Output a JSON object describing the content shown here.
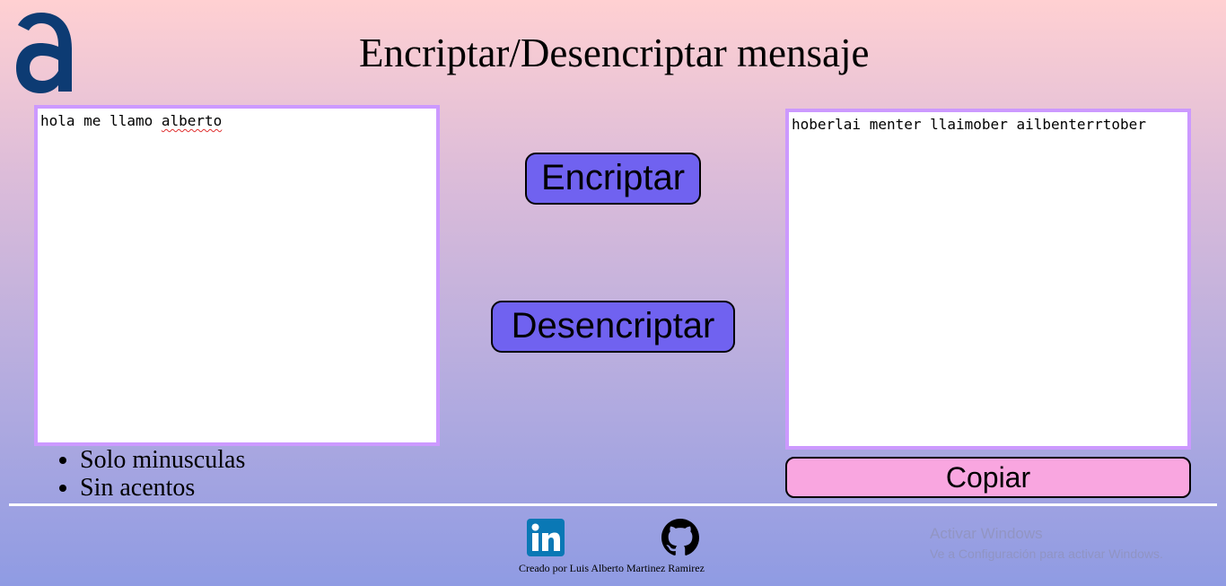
{
  "header": {
    "logo_icon": "alura-a-logo-icon",
    "title": "Encriptar/Desencriptar mensaje"
  },
  "input": {
    "value_prefix": "hola me llamo ",
    "value_misspelled": "alberto",
    "rules": [
      "Solo minusculas",
      "Sin acentos"
    ]
  },
  "actions": {
    "encrypt_label": "Encriptar",
    "decrypt_label": "Desencriptar",
    "copy_label": "Copiar"
  },
  "output": {
    "value": "hoberlai menter llaimober ailbenterrtober"
  },
  "footer": {
    "linkedin_icon": "linkedin-icon",
    "github_icon": "github-icon",
    "credit": "Creado por Luis Alberto Martinez Ramirez"
  },
  "os_watermark": {
    "title": "Activar Windows",
    "subtitle": "Ve a Configuración para activar Windows."
  },
  "colors": {
    "accent_border": "#cc99ff",
    "button": "#7062f0",
    "copy_button": "#f9a6e0",
    "logo": "#0d3b73"
  }
}
